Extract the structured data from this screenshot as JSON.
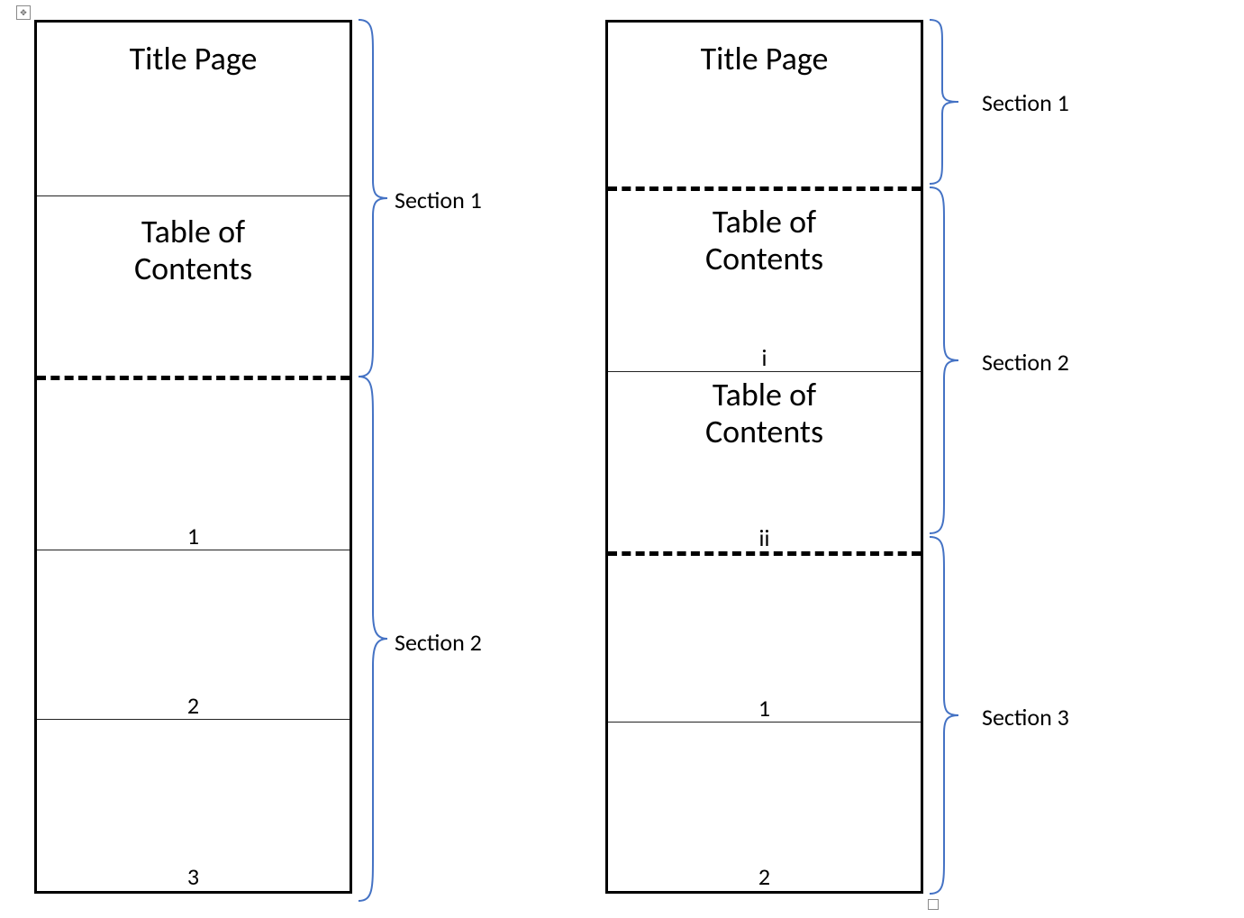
{
  "colors": {
    "brace": "#4472C4"
  },
  "left": {
    "pages": [
      {
        "title": "Title Page",
        "page_number": ""
      },
      {
        "title": "Table of\nContents",
        "page_number": ""
      },
      {
        "title": "",
        "page_number": "1"
      },
      {
        "title": "",
        "page_number": "2"
      },
      {
        "title": "",
        "page_number": "3"
      }
    ],
    "sections": [
      {
        "label": "Section 1"
      },
      {
        "label": "Section 2"
      }
    ]
  },
  "right": {
    "pages": [
      {
        "title": "Title Page",
        "page_number": ""
      },
      {
        "title": "Table of\nContents",
        "page_number": "i"
      },
      {
        "title": "Table of\nContents",
        "page_number": "ii"
      },
      {
        "title": "",
        "page_number": "1"
      },
      {
        "title": "",
        "page_number": "2"
      }
    ],
    "sections": [
      {
        "label": "Section 1"
      },
      {
        "label": "Section 2"
      },
      {
        "label": "Section 3"
      }
    ]
  }
}
